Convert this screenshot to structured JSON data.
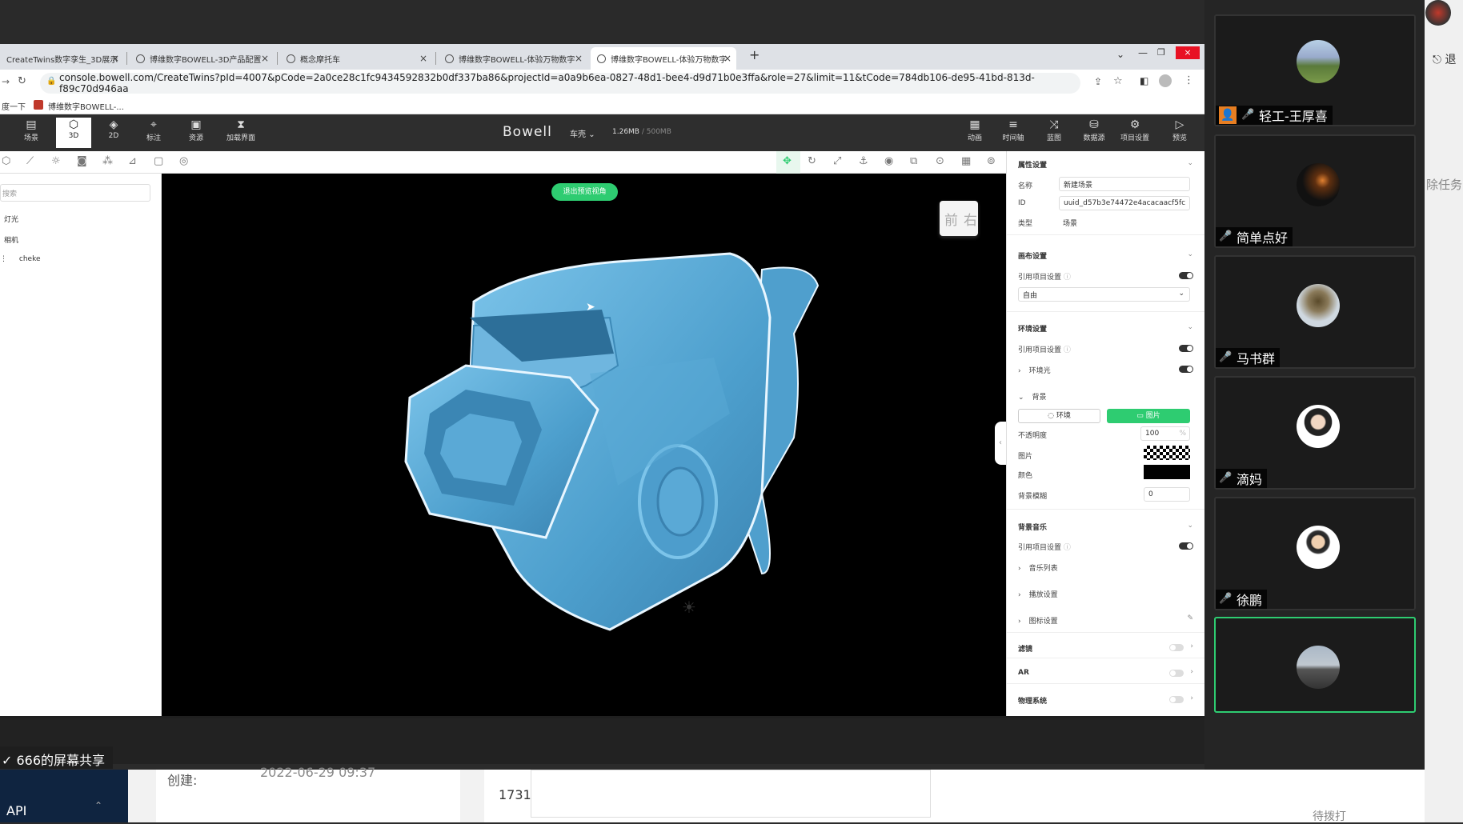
{
  "browser": {
    "tabs": [
      {
        "label": "CreateTwins数字孪生_3D展示"
      },
      {
        "label": "博维数字BOWELL-3D产品配置"
      },
      {
        "label": "概念摩托车"
      },
      {
        "label": "博维数字BOWELL-体验万物数字"
      },
      {
        "label": "博维数字BOWELL-体验万物数字"
      }
    ],
    "new_tab": "+",
    "url": "console.bowell.com/CreateTwins?pId=4007&pCode=2a0ce28c1fc9434592832b0df337ba86&projectId=a0a9b6ea-0827-48d1-bee4-d9d71b0e3ffa&role=27&limit=11&tCode=784db106-de95-41bd-813d-f89c70d946aa",
    "bookmarks": [
      {
        "label": "度一下"
      },
      {
        "label": "博维数字BOWELL-..."
      }
    ]
  },
  "toolbar": {
    "left": [
      {
        "icon": "scene-icon",
        "label": "场景"
      },
      {
        "icon": "cube-icon",
        "label": "3D"
      },
      {
        "icon": "layers-icon",
        "label": "2D"
      },
      {
        "icon": "pin-icon",
        "label": "标注"
      },
      {
        "icon": "box-icon",
        "label": "资源"
      },
      {
        "icon": "hourglass-icon",
        "label": "加载界面"
      }
    ],
    "brand": "Bowell",
    "model_name": "车壳",
    "size_used": "1.26MB",
    "size_total": "/ 500MB",
    "right": [
      {
        "icon": "film-icon",
        "label": "动画"
      },
      {
        "icon": "timeline-icon",
        "label": "时间轴"
      },
      {
        "icon": "blueprint-icon",
        "label": "蓝图"
      },
      {
        "icon": "database-icon",
        "label": "数据源"
      },
      {
        "icon": "gear-icon",
        "label": "项目设置"
      },
      {
        "icon": "play-icon",
        "label": "预览"
      }
    ]
  },
  "left_panel": {
    "search_placeholder": "搜索",
    "tree": [
      {
        "label": "灯光"
      },
      {
        "label": "相机"
      },
      {
        "label": "cheke"
      }
    ]
  },
  "viewport": {
    "exit_preview": "退出预览视角",
    "viewcube_front": "前",
    "viewcube_right": "右"
  },
  "properties": {
    "section_title": "属性设置",
    "name_label": "名称",
    "name_value": "新建场景",
    "id_label": "ID",
    "id_value": "uuid_d57b3e74472e4acacaacf5fc",
    "type_label": "类型",
    "type_value": "场景",
    "canvas_title": "画布设置",
    "use_project_settings": "引用项目设置",
    "canvas_mode": "自由",
    "env_title": "环境设置",
    "ambient_light": "环境光",
    "background": "背景",
    "bg_env_btn": "环境",
    "bg_image_btn": "图片",
    "opacity_label": "不透明度",
    "opacity_value": "100",
    "opacity_unit": "%",
    "image_label": "图片",
    "color_label": "颜色",
    "blur_label": "背景模糊",
    "blur_value": "0",
    "music_title": "背景音乐",
    "music_list": "音乐列表",
    "playback_settings": "播放设置",
    "icon_settings": "图标设置",
    "filter_title": "滤镜",
    "ar_title": "AR",
    "physics_title": "物理系统"
  },
  "share_label": "666的屏幕共享",
  "participants": [
    {
      "name": "轻工-王厚喜",
      "avatar": "landscape-avatar"
    },
    {
      "name": "简单点好",
      "avatar": "dark-avatar"
    },
    {
      "name": "马书群",
      "avatar": "tree-avatar"
    },
    {
      "name": "滴妈",
      "avatar": "woman-avatar"
    },
    {
      "name": "徐鹏",
      "avatar": "man-avatar"
    },
    {
      "name": "",
      "avatar": "road-avatar"
    }
  ],
  "underlay": {
    "api_label": "API",
    "created_label": "创建:",
    "created_value": "2022-06-29 09:37",
    "number_value": "1731",
    "right_text": "待拨打",
    "edge_text_1": "退",
    "edge_text_2": "除任务"
  },
  "colors": {
    "accent_green": "#2ecc71",
    "model_blue": "#5aa9d6"
  }
}
